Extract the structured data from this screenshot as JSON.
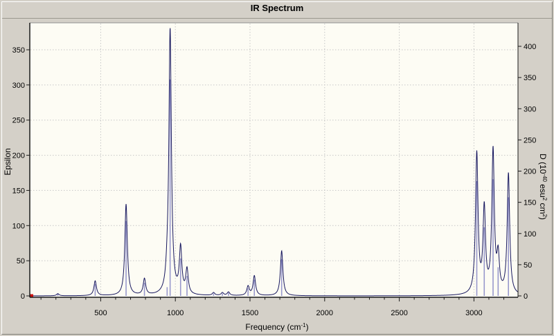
{
  "chart_data": {
    "type": "line",
    "title": "IR Spectrum",
    "x_axis": {
      "label_parts": [
        {
          "t": "Frequency (cm"
        },
        {
          "t": "-1",
          "sup": true
        },
        {
          "t": ")"
        }
      ],
      "min": 25,
      "max": 3295,
      "major_ticks": [
        500,
        1000,
        1500,
        2000,
        2500,
        3000
      ],
      "major_tick_labels": [
        "500",
        "1000",
        "1500",
        "2000",
        "2500",
        "3000"
      ],
      "minor_tick_interval": 100
    },
    "y_left": {
      "label": "Epsilon",
      "min": 0,
      "max": 390,
      "ticks": [
        0,
        50,
        100,
        150,
        200,
        250,
        300,
        350
      ],
      "tick_labels": [
        "0",
        "50",
        "100",
        "150",
        "200",
        "250",
        "300",
        "350"
      ]
    },
    "y_right": {
      "label_parts": [
        {
          "t": "D (10"
        },
        {
          "t": "-40",
          "sup": true
        },
        {
          "t": " esu"
        },
        {
          "t": "2",
          "sup": true
        },
        {
          "t": " cm"
        },
        {
          "t": "2",
          "sup": true
        },
        {
          "t": ")"
        }
      ],
      "min": 0,
      "max": 437,
      "ticks": [
        0,
        50,
        100,
        150,
        200,
        250,
        300,
        350,
        400
      ],
      "tick_labels": [
        "0",
        "50",
        "100",
        "150",
        "200",
        "250",
        "300",
        "350",
        "400"
      ]
    },
    "grid": true,
    "legend": "none",
    "lorentzian_hwhm": 10,
    "peaks": [
      {
        "frequency": 213,
        "epsilon": 3,
        "d": 3
      },
      {
        "frequency": 463,
        "epsilon": 21,
        "d": 19
      },
      {
        "frequency": 670,
        "epsilon": 130,
        "d": 120
      },
      {
        "frequency": 793,
        "epsilon": 23,
        "d": 21
      },
      {
        "frequency": 945,
        "epsilon": 15,
        "d": 14
      },
      {
        "frequency": 965,
        "epsilon": 377,
        "d": 347
      },
      {
        "frequency": 1035,
        "epsilon": 65,
        "d": 60
      },
      {
        "frequency": 1078,
        "epsilon": 35,
        "d": 32
      },
      {
        "frequency": 1256,
        "epsilon": 4,
        "d": 4
      },
      {
        "frequency": 1315,
        "epsilon": 4,
        "d": 4
      },
      {
        "frequency": 1356,
        "epsilon": 5,
        "d": 5
      },
      {
        "frequency": 1487,
        "epsilon": 13,
        "d": 12
      },
      {
        "frequency": 1529,
        "epsilon": 28,
        "d": 26
      },
      {
        "frequency": 1712,
        "epsilon": 64,
        "d": 59
      },
      {
        "frequency": 3019,
        "epsilon": 200,
        "d": 184
      },
      {
        "frequency": 3069,
        "epsilon": 120,
        "d": 110
      },
      {
        "frequency": 3128,
        "epsilon": 203,
        "d": 187
      },
      {
        "frequency": 3162,
        "epsilon": 50,
        "d": 46
      },
      {
        "frequency": 3231,
        "epsilon": 172,
        "d": 158
      }
    ],
    "colors": {
      "background": "#d4d0c8",
      "plot_background": "#fdfcf4",
      "curve": "#16165e",
      "stick": "#9898cc",
      "grid": "#c6c6c6",
      "axis": "#1a1a1a",
      "axis_top": "#909090",
      "origin_marker": "#cc1111"
    }
  }
}
